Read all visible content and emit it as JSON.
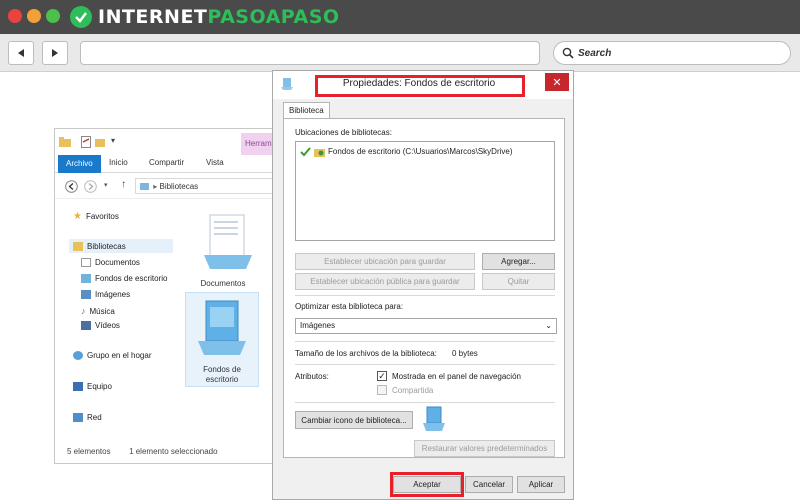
{
  "browser": {
    "logo_text_white": "INTERNET",
    "logo_text_green": "PASOAPASO",
    "search_placeholder": "Search",
    "colors": {
      "close_dot": "#e8433c",
      "min_dot": "#f2a03a",
      "max_dot": "#4cc04a",
      "brand_green": "#2ebd59",
      "highlight_red": "#e8202a"
    }
  },
  "explorer": {
    "tab_label_partial": "Herram",
    "ribbon_tabs": [
      "Archivo",
      "Inicio",
      "Compartir",
      "Vista"
    ],
    "address_path": "Bibliotecas",
    "nav": {
      "favoritos": "Favoritos",
      "bibliotecas": "Bibliotecas",
      "documentos": "Documentos",
      "fondos": "Fondos de escritorio",
      "imagenes": "Imágenes",
      "musica": "Música",
      "videos": "Vídeos",
      "grupo_hogar": "Grupo en el hogar",
      "equipo": "Equipo",
      "red": "Red"
    },
    "items": {
      "documentos_label": "Documentos",
      "fondos_label_1": "Fondos de",
      "fondos_label_2": "escritorio"
    },
    "status": {
      "count": "5 elementos",
      "selected": "1 elemento seleccionado"
    }
  },
  "dialog": {
    "title": "Propiedades: Fondos de escritorio",
    "close_glyph": "✕",
    "tab": "Biblioteca",
    "locations_label": "Ubicaciones de bibliotecas:",
    "location_entry": "Fondos de escritorio (C:\\Usuarios\\Marcos\\SkyDrive)",
    "set_save_location": "Establecer ubicación para guardar",
    "add_button": "Agregar...",
    "set_public_save_location": "Establecer ubicación pública para guardar",
    "remove_button": "Quitar",
    "optimize_label": "Optimizar esta biblioteca para:",
    "optimize_value": "Imágenes",
    "size_label": "Tamaño de los archivos de la biblioteca:",
    "size_value": "0 bytes",
    "attributes_label": "Atributos:",
    "shown_in_nav": "Mostrada en el panel de navegación",
    "shared": "Compartida",
    "change_icon_button": "Cambiar icono de biblioteca...",
    "restore_defaults_button": "Restaurar valores predeterminados",
    "ok_button": "Aceptar",
    "cancel_button": "Cancelar",
    "apply_button": "Aplicar"
  }
}
